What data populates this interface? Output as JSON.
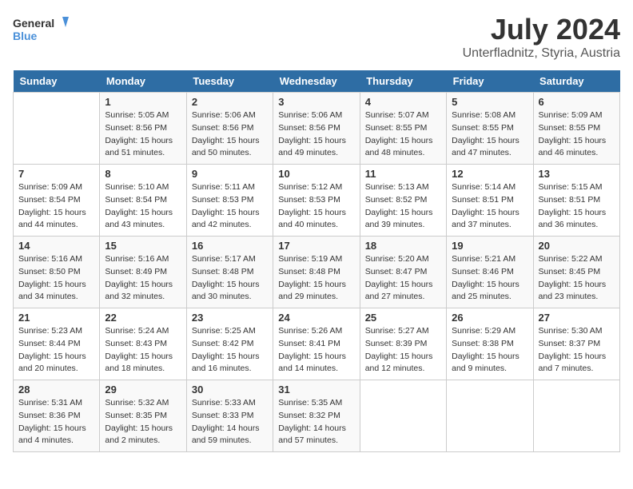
{
  "header": {
    "logo_line1": "General",
    "logo_line2": "Blue",
    "title": "July 2024",
    "subtitle": "Unterfladnitz, Styria, Austria"
  },
  "weekdays": [
    "Sunday",
    "Monday",
    "Tuesday",
    "Wednesday",
    "Thursday",
    "Friday",
    "Saturday"
  ],
  "weeks": [
    [
      {
        "day": "",
        "info": ""
      },
      {
        "day": "1",
        "info": "Sunrise: 5:05 AM\nSunset: 8:56 PM\nDaylight: 15 hours\nand 51 minutes."
      },
      {
        "day": "2",
        "info": "Sunrise: 5:06 AM\nSunset: 8:56 PM\nDaylight: 15 hours\nand 50 minutes."
      },
      {
        "day": "3",
        "info": "Sunrise: 5:06 AM\nSunset: 8:56 PM\nDaylight: 15 hours\nand 49 minutes."
      },
      {
        "day": "4",
        "info": "Sunrise: 5:07 AM\nSunset: 8:55 PM\nDaylight: 15 hours\nand 48 minutes."
      },
      {
        "day": "5",
        "info": "Sunrise: 5:08 AM\nSunset: 8:55 PM\nDaylight: 15 hours\nand 47 minutes."
      },
      {
        "day": "6",
        "info": "Sunrise: 5:09 AM\nSunset: 8:55 PM\nDaylight: 15 hours\nand 46 minutes."
      }
    ],
    [
      {
        "day": "7",
        "info": "Sunrise: 5:09 AM\nSunset: 8:54 PM\nDaylight: 15 hours\nand 44 minutes."
      },
      {
        "day": "8",
        "info": "Sunrise: 5:10 AM\nSunset: 8:54 PM\nDaylight: 15 hours\nand 43 minutes."
      },
      {
        "day": "9",
        "info": "Sunrise: 5:11 AM\nSunset: 8:53 PM\nDaylight: 15 hours\nand 42 minutes."
      },
      {
        "day": "10",
        "info": "Sunrise: 5:12 AM\nSunset: 8:53 PM\nDaylight: 15 hours\nand 40 minutes."
      },
      {
        "day": "11",
        "info": "Sunrise: 5:13 AM\nSunset: 8:52 PM\nDaylight: 15 hours\nand 39 minutes."
      },
      {
        "day": "12",
        "info": "Sunrise: 5:14 AM\nSunset: 8:51 PM\nDaylight: 15 hours\nand 37 minutes."
      },
      {
        "day": "13",
        "info": "Sunrise: 5:15 AM\nSunset: 8:51 PM\nDaylight: 15 hours\nand 36 minutes."
      }
    ],
    [
      {
        "day": "14",
        "info": "Sunrise: 5:16 AM\nSunset: 8:50 PM\nDaylight: 15 hours\nand 34 minutes."
      },
      {
        "day": "15",
        "info": "Sunrise: 5:16 AM\nSunset: 8:49 PM\nDaylight: 15 hours\nand 32 minutes."
      },
      {
        "day": "16",
        "info": "Sunrise: 5:17 AM\nSunset: 8:48 PM\nDaylight: 15 hours\nand 30 minutes."
      },
      {
        "day": "17",
        "info": "Sunrise: 5:19 AM\nSunset: 8:48 PM\nDaylight: 15 hours\nand 29 minutes."
      },
      {
        "day": "18",
        "info": "Sunrise: 5:20 AM\nSunset: 8:47 PM\nDaylight: 15 hours\nand 27 minutes."
      },
      {
        "day": "19",
        "info": "Sunrise: 5:21 AM\nSunset: 8:46 PM\nDaylight: 15 hours\nand 25 minutes."
      },
      {
        "day": "20",
        "info": "Sunrise: 5:22 AM\nSunset: 8:45 PM\nDaylight: 15 hours\nand 23 minutes."
      }
    ],
    [
      {
        "day": "21",
        "info": "Sunrise: 5:23 AM\nSunset: 8:44 PM\nDaylight: 15 hours\nand 20 minutes."
      },
      {
        "day": "22",
        "info": "Sunrise: 5:24 AM\nSunset: 8:43 PM\nDaylight: 15 hours\nand 18 minutes."
      },
      {
        "day": "23",
        "info": "Sunrise: 5:25 AM\nSunset: 8:42 PM\nDaylight: 15 hours\nand 16 minutes."
      },
      {
        "day": "24",
        "info": "Sunrise: 5:26 AM\nSunset: 8:41 PM\nDaylight: 15 hours\nand 14 minutes."
      },
      {
        "day": "25",
        "info": "Sunrise: 5:27 AM\nSunset: 8:39 PM\nDaylight: 15 hours\nand 12 minutes."
      },
      {
        "day": "26",
        "info": "Sunrise: 5:29 AM\nSunset: 8:38 PM\nDaylight: 15 hours\nand 9 minutes."
      },
      {
        "day": "27",
        "info": "Sunrise: 5:30 AM\nSunset: 8:37 PM\nDaylight: 15 hours\nand 7 minutes."
      }
    ],
    [
      {
        "day": "28",
        "info": "Sunrise: 5:31 AM\nSunset: 8:36 PM\nDaylight: 15 hours\nand 4 minutes."
      },
      {
        "day": "29",
        "info": "Sunrise: 5:32 AM\nSunset: 8:35 PM\nDaylight: 15 hours\nand 2 minutes."
      },
      {
        "day": "30",
        "info": "Sunrise: 5:33 AM\nSunset: 8:33 PM\nDaylight: 14 hours\nand 59 minutes."
      },
      {
        "day": "31",
        "info": "Sunrise: 5:35 AM\nSunset: 8:32 PM\nDaylight: 14 hours\nand 57 minutes."
      },
      {
        "day": "",
        "info": ""
      },
      {
        "day": "",
        "info": ""
      },
      {
        "day": "",
        "info": ""
      }
    ]
  ]
}
